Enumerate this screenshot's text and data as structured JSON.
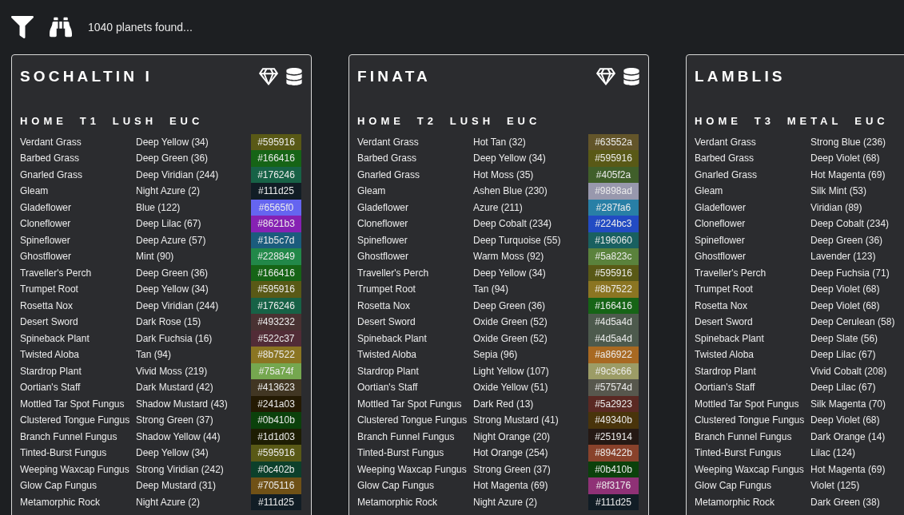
{
  "toolbar": {
    "status": "1040 planets found..."
  },
  "planets": [
    {
      "name": "SOCHALTIN I",
      "gem": true,
      "database": true,
      "tags": [
        "HOME",
        "T1",
        "LUSH",
        "EUC"
      ],
      "rows": [
        {
          "plant": "Verdant Grass",
          "color_name": "Deep Yellow (34)",
          "hex": "#595916",
          "color": "#595916"
        },
        {
          "plant": "Barbed Grass",
          "color_name": "Deep Green (36)",
          "hex": "#166416",
          "color": "#166416"
        },
        {
          "plant": "Gnarled Grass",
          "color_name": "Deep Viridian (244)",
          "hex": "#176246",
          "color": "#176246"
        },
        {
          "plant": "Gleam",
          "color_name": "Night Azure (2)",
          "hex": "#111d25",
          "color": "#111d25"
        },
        {
          "plant": "Gladeflower",
          "color_name": "Blue (122)",
          "hex": "#6565f0",
          "color": "#6565f0"
        },
        {
          "plant": "Cloneflower",
          "color_name": "Deep Lilac (67)",
          "hex": "#8621b3",
          "color": "#8621b3"
        },
        {
          "plant": "Spineflower",
          "color_name": "Deep Azure (57)",
          "hex": "#1b5c7d",
          "color": "#1b5c7d"
        },
        {
          "plant": "Ghostflower",
          "color_name": "Mint (90)",
          "hex": "#228849",
          "color": "#228849"
        },
        {
          "plant": "Traveller's Perch",
          "color_name": "Deep Green (36)",
          "hex": "#166416",
          "color": "#166416"
        },
        {
          "plant": "Trumpet Root",
          "color_name": "Deep Yellow (34)",
          "hex": "#595916",
          "color": "#595916"
        },
        {
          "plant": "Rosetta Nox",
          "color_name": "Deep Viridian (244)",
          "hex": "#176246",
          "color": "#176246"
        },
        {
          "plant": "Desert Sword",
          "color_name": "Dark Rose (15)",
          "hex": "#493232",
          "color": "#493232"
        },
        {
          "plant": "Spineback Plant",
          "color_name": "Dark Fuchsia (16)",
          "hex": "#522c37",
          "color": "#522c37"
        },
        {
          "plant": "Twisted Aloba",
          "color_name": "Tan (94)",
          "hex": "#8b7522",
          "color": "#8b7522"
        },
        {
          "plant": "Stardrop Plant",
          "color_name": "Vivid Moss (219)",
          "hex": "#75a74f",
          "color": "#75a74f"
        },
        {
          "plant": "Oortian's Staff",
          "color_name": "Dark Mustard (42)",
          "hex": "#413623",
          "color": "#413623"
        },
        {
          "plant": "Mottled Tar Spot Fungus",
          "color_name": "Shadow Mustard (43)",
          "hex": "#241a03",
          "color": "#241a03"
        },
        {
          "plant": "Clustered Tongue Fungus",
          "color_name": "Strong Green (37)",
          "hex": "#0b410b",
          "color": "#0b410b"
        },
        {
          "plant": "Branch Funnel Fungus",
          "color_name": "Shadow Yellow (44)",
          "hex": "#1d1d03",
          "color": "#1d1d03"
        },
        {
          "plant": "Tinted-Burst Fungus",
          "color_name": "Deep Yellow (34)",
          "hex": "#595916",
          "color": "#595916"
        },
        {
          "plant": "Weeping Waxcap Fungus",
          "color_name": "Strong Viridian (242)",
          "hex": "#0c402b",
          "color": "#0c402b"
        },
        {
          "plant": "Glow Cap Fungus",
          "color_name": "Deep Mustard (31)",
          "hex": "#705116",
          "color": "#705116"
        },
        {
          "plant": "Metamorphic Rock",
          "color_name": "Night Azure (2)",
          "hex": "#111d25",
          "color": "#111d25"
        }
      ]
    },
    {
      "name": "FINATA",
      "gem": true,
      "database": true,
      "tags": [
        "HOME",
        "T2",
        "LUSH",
        "EUC"
      ],
      "rows": [
        {
          "plant": "Verdant Grass",
          "color_name": "Hot Tan (32)",
          "hex": "#63552a",
          "color": "#63552a"
        },
        {
          "plant": "Barbed Grass",
          "color_name": "Deep Yellow (34)",
          "hex": "#595916",
          "color": "#595916"
        },
        {
          "plant": "Gnarled Grass",
          "color_name": "Hot Moss (35)",
          "hex": "#405f2a",
          "color": "#405f2a"
        },
        {
          "plant": "Gleam",
          "color_name": "Ashen Blue (230)",
          "hex": "#9898ad",
          "color": "#9898ad"
        },
        {
          "plant": "Gladeflower",
          "color_name": "Azure (211)",
          "hex": "#287fa6",
          "color": "#287fa6"
        },
        {
          "plant": "Cloneflower",
          "color_name": "Deep Cobalt (234)",
          "hex": "#224bc3",
          "color": "#224bc3"
        },
        {
          "plant": "Spineflower",
          "color_name": "Deep Turquoise (55)",
          "hex": "#196060",
          "color": "#196060"
        },
        {
          "plant": "Ghostflower",
          "color_name": "Warm Moss (92)",
          "hex": "#5a823c",
          "color": "#5a823c"
        },
        {
          "plant": "Traveller's Perch",
          "color_name": "Deep Yellow (34)",
          "hex": "#595916",
          "color": "#595916"
        },
        {
          "plant": "Trumpet Root",
          "color_name": "Tan (94)",
          "hex": "#8b7522",
          "color": "#8b7522"
        },
        {
          "plant": "Rosetta Nox",
          "color_name": "Deep Green (36)",
          "hex": "#166416",
          "color": "#166416"
        },
        {
          "plant": "Desert Sword",
          "color_name": "Oxide Green (52)",
          "hex": "#4d5a4d",
          "color": "#4d5a4d"
        },
        {
          "plant": "Spineback Plant",
          "color_name": "Oxide Green (52)",
          "hex": "#4d5a4d",
          "color": "#4d5a4d"
        },
        {
          "plant": "Twisted Aloba",
          "color_name": "Sepia (96)",
          "hex": "#a86922",
          "color": "#a86922"
        },
        {
          "plant": "Stardrop Plant",
          "color_name": "Light Yellow (107)",
          "hex": "#9c9c66",
          "color": "#9c9c66"
        },
        {
          "plant": "Oortian's Staff",
          "color_name": "Oxide Yellow (51)",
          "hex": "#57574d",
          "color": "#57574d"
        },
        {
          "plant": "Mottled Tar Spot Fungus",
          "color_name": "Dark Red (13)",
          "hex": "#5a2923",
          "color": "#5a2923"
        },
        {
          "plant": "Clustered Tongue Fungus",
          "color_name": "Strong Mustard (41)",
          "hex": "#49340b",
          "color": "#49340b"
        },
        {
          "plant": "Branch Funnel Fungus",
          "color_name": "Night Orange (20)",
          "hex": "#251914",
          "color": "#251914"
        },
        {
          "plant": "Tinted-Burst Fungus",
          "color_name": "Hot Orange (254)",
          "hex": "#89422b",
          "color": "#89422b"
        },
        {
          "plant": "Weeping Waxcap Fungus",
          "color_name": "Strong Green (37)",
          "hex": "#0b410b",
          "color": "#0b410b"
        },
        {
          "plant": "Glow Cap Fungus",
          "color_name": "Hot Magenta (69)",
          "hex": "#8f3176",
          "color": "#8f3176"
        },
        {
          "plant": "Metamorphic Rock",
          "color_name": "Night Azure (2)",
          "hex": "#111d25",
          "color": "#111d25"
        }
      ]
    },
    {
      "name": "LAMBLIS",
      "tags": [
        "HOME",
        "T3",
        "METAL",
        "EUC"
      ],
      "rows": [
        {
          "plant": "Verdant Grass",
          "color_name": "Strong Blue (236)"
        },
        {
          "plant": "Barbed Grass",
          "color_name": "Deep Violet (68)"
        },
        {
          "plant": "Gnarled Grass",
          "color_name": "Hot Magenta (69)"
        },
        {
          "plant": "Gleam",
          "color_name": "Silk Mint (53)"
        },
        {
          "plant": "Gladeflower",
          "color_name": "Viridian (89)"
        },
        {
          "plant": "Cloneflower",
          "color_name": "Deep Cobalt (234)"
        },
        {
          "plant": "Spineflower",
          "color_name": "Deep Green (36)"
        },
        {
          "plant": "Ghostflower",
          "color_name": "Lavender (123)"
        },
        {
          "plant": "Traveller's Perch",
          "color_name": "Deep Fuchsia (71)"
        },
        {
          "plant": "Trumpet Root",
          "color_name": "Deep Violet (68)"
        },
        {
          "plant": "Rosetta Nox",
          "color_name": "Deep Violet (68)"
        },
        {
          "plant": "Desert Sword",
          "color_name": "Deep Cerulean (58)"
        },
        {
          "plant": "Spineback Plant",
          "color_name": "Deep Slate (56)"
        },
        {
          "plant": "Twisted Aloba",
          "color_name": "Deep Lilac (67)"
        },
        {
          "plant": "Stardrop Plant",
          "color_name": "Vivid Cobalt (208)"
        },
        {
          "plant": "Oortian's Staff",
          "color_name": "Deep Lilac (67)"
        },
        {
          "plant": "Mottled Tar Spot Fungus",
          "color_name": "Silk Magenta (70)"
        },
        {
          "plant": "Clustered Tongue Fungus",
          "color_name": "Deep Violet (68)"
        },
        {
          "plant": "Branch Funnel Fungus",
          "color_name": "Dark Orange (14)"
        },
        {
          "plant": "Tinted-Burst Fungus",
          "color_name": "Lilac (124)"
        },
        {
          "plant": "Weeping Waxcap Fungus",
          "color_name": "Hot Magenta (69)"
        },
        {
          "plant": "Glow Cap Fungus",
          "color_name": "Violet (125)"
        },
        {
          "plant": "Metamorphic Rock",
          "color_name": "Dark Green (38)"
        }
      ]
    }
  ]
}
